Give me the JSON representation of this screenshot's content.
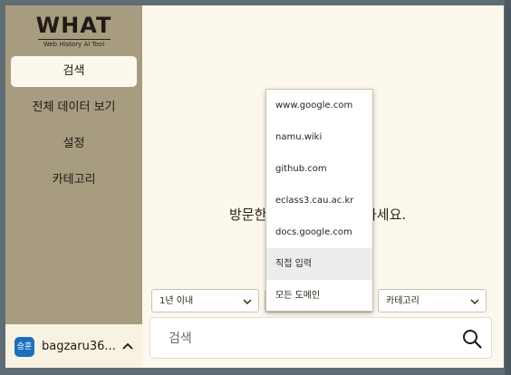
{
  "app": {
    "logo_title": "WHAT",
    "logo_subtitle": "Web History AI Tool"
  },
  "sidebar": {
    "items": [
      {
        "label": "검색",
        "active": true
      },
      {
        "label": "전체 데이터 보기",
        "active": false
      },
      {
        "label": "설정",
        "active": false
      },
      {
        "label": "카테고리",
        "active": false
      }
    ]
  },
  "user": {
    "avatar_text": "승훈",
    "name": "bagzaru36...",
    "avatar_color": "#1d6fbd"
  },
  "main": {
    "message_left": "방문한",
    "message_right": "하세요."
  },
  "filters": {
    "period_value": "1년 이내",
    "domain_value": "",
    "category_value": "카테고리"
  },
  "domain_dropdown": {
    "options": [
      {
        "label": "www.google.com"
      },
      {
        "label": "namu.wiki"
      },
      {
        "label": "github.com"
      },
      {
        "label": "eclass3.cau.ac.kr"
      },
      {
        "label": "docs.google.com"
      },
      {
        "label": "직접 입력",
        "highlighted": true
      },
      {
        "label": "모든 도메인"
      }
    ]
  },
  "search": {
    "placeholder": "검색"
  },
  "colors": {
    "sidebar_bg": "#a79c80",
    "main_bg": "#fdf8ec",
    "accent_blue": "#1d6fbd"
  }
}
